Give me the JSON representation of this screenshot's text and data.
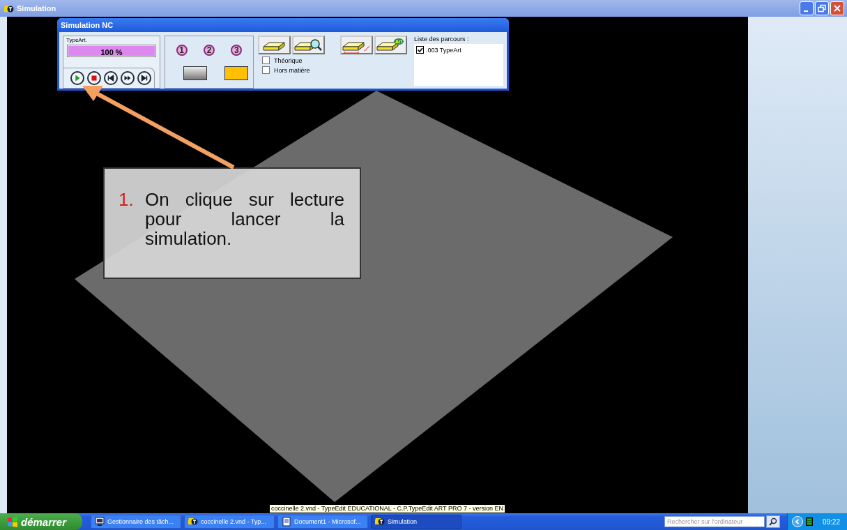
{
  "window": {
    "title": "Simulation"
  },
  "dialog": {
    "title": "Simulation NC",
    "progress_label": "TypeArt.",
    "progress": {
      "level": 1,
      "reading": "100 %"
    },
    "step_numbers": [
      "1",
      "2",
      "3"
    ],
    "art_badge": "Art",
    "checkboxes": [
      {
        "label": "Théorique",
        "checked": false
      },
      {
        "label": "Hors matière",
        "checked": false
      }
    ],
    "path_list": {
      "label": "Liste des parcours :",
      "items": [
        {
          "label": ".003 TypeArt",
          "checked": true
        }
      ]
    }
  },
  "callout": {
    "number": "1.",
    "text": "On clique sur lecture pour lancer la simulation."
  },
  "tooltip": "coccinelle 2.vnd - TypeEdit  EDUCATIONAL - C.P.TypeEdit  ART PRO 7 - version EN",
  "taskbar": {
    "start": "démarrer",
    "tasks": [
      {
        "label": "Gestionnaire des tâch...",
        "kind": "monitor",
        "selected": false
      },
      {
        "label": "coccinelle 2.vnd - Typ...",
        "kind": "typeedit",
        "selected": false
      },
      {
        "label": "Document1 - Microsof...",
        "kind": "document",
        "selected": false
      },
      {
        "label": "Simulation",
        "kind": "typeedit",
        "selected": true
      }
    ],
    "search": {
      "placeholder": "Rechercher sur l'ordinateur"
    },
    "clock": "09:22"
  }
}
